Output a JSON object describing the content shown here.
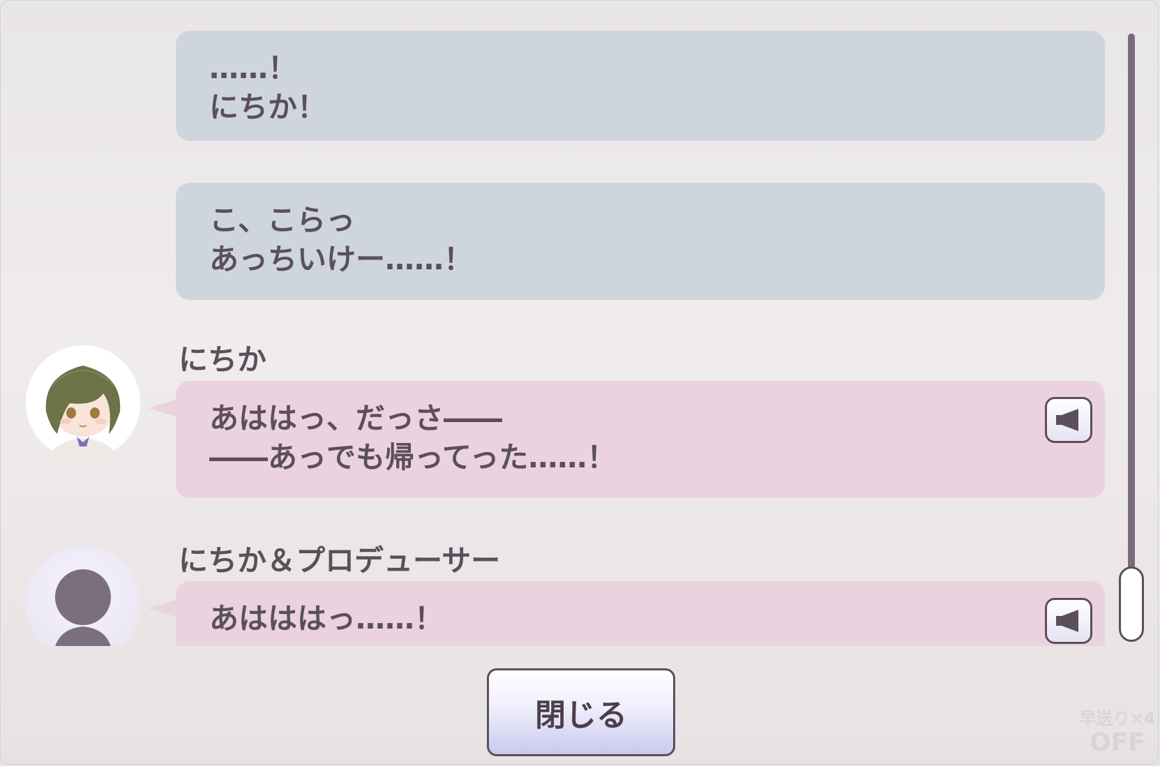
{
  "log": {
    "entries": [
      {
        "type": "narration",
        "lines": [
          "……！",
          "にちか！"
        ]
      },
      {
        "type": "narration",
        "lines": [
          "こ、こらっ",
          "あっちいけー……！"
        ]
      },
      {
        "type": "dialogue",
        "speaker": "にちか",
        "avatar": "character-portrait",
        "lines": [
          "あははっ、だっさ――",
          "――あっでも帰ってった……！"
        ],
        "voice": true
      },
      {
        "type": "dialogue",
        "speaker": "にちか＆プロデューサー",
        "avatar": "silhouette",
        "lines": [
          "あはははっ……！"
        ],
        "voice": true
      }
    ]
  },
  "footer": {
    "close_label": "閉じる"
  },
  "fast_forward": {
    "label": "早送り×4",
    "state": "OFF"
  },
  "colors": {
    "text": "#5b4f5c",
    "narration_bubble": "#cfd5dc",
    "dialogue_bubble": "#ead3df",
    "scrollbar": "#7a6c7b"
  },
  "icons": {
    "voice": "speaker-icon"
  }
}
